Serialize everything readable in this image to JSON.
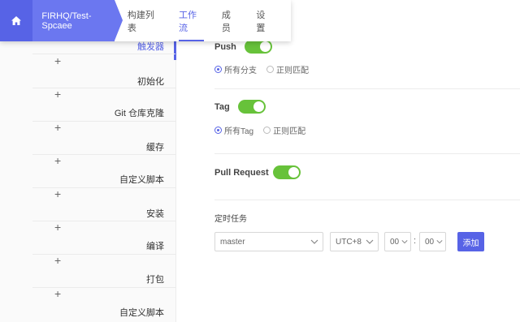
{
  "nav": {
    "project": "FIRHQ/Test-Spcaee",
    "tabs": [
      {
        "label": "构建列表"
      },
      {
        "label": "工作流"
      },
      {
        "label": "成员"
      },
      {
        "label": "设置"
      }
    ],
    "active_tab": "工作流"
  },
  "stages": [
    {
      "label": "触发器"
    },
    {
      "label": "初始化"
    },
    {
      "label": "Git 仓库克隆"
    },
    {
      "label": "缓存"
    },
    {
      "label": "自定义脚本"
    },
    {
      "label": "安装"
    },
    {
      "label": "编译"
    },
    {
      "label": "打包"
    },
    {
      "label": "自定义脚本"
    }
  ],
  "add_symbol": "+",
  "triggers": {
    "push": {
      "label": "Push",
      "enabled": true,
      "options": [
        "所有分支",
        "正则匹配"
      ],
      "selected": "所有分支"
    },
    "tag": {
      "label": "Tag",
      "enabled": true,
      "options": [
        "所有Tag",
        "正则匹配"
      ],
      "selected": "所有Tag"
    },
    "pull_request": {
      "label": "Pull Request",
      "enabled": true
    }
  },
  "schedule": {
    "title": "定时任务",
    "branch": "master",
    "timezone": "UTC+8",
    "hour": "00",
    "minute": "00",
    "separator": ":",
    "add_label": "添加"
  },
  "colors": {
    "accent": "#5763e6",
    "toggle_on": "#67c23a"
  }
}
